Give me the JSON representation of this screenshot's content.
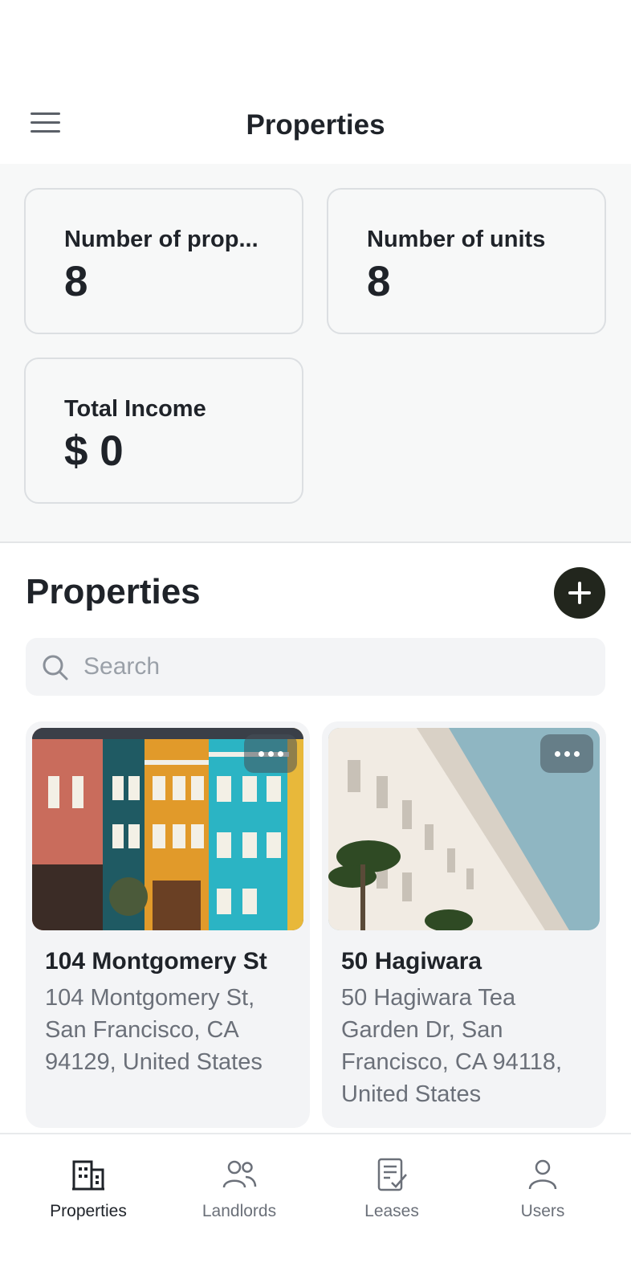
{
  "header": {
    "title": "Properties",
    "menu_icon": "menu-icon"
  },
  "stats": [
    {
      "label": "Number of prop...",
      "value": "8"
    },
    {
      "label": "Number of units",
      "value": "8"
    },
    {
      "label": "Total Income",
      "value": "$ 0"
    }
  ],
  "section": {
    "title": "Properties",
    "add_icon": "plus-icon"
  },
  "search": {
    "placeholder": "Search",
    "value": ""
  },
  "properties": [
    {
      "name": "104 Montgomery St",
      "address": "104 Montgomery St, San Francisco, CA 94129, United States",
      "image": "colorful-townhouses-photo"
    },
    {
      "name": "50 Hagiwara",
      "address": "50 Hagiwara Tea Garden Dr, San Francisco, CA 94118, United States",
      "image": "white-building-palms-photo"
    }
  ],
  "nav": [
    {
      "label": "Properties",
      "icon": "building-icon",
      "active": true
    },
    {
      "label": "Landlords",
      "icon": "people-icon",
      "active": false
    },
    {
      "label": "Leases",
      "icon": "document-check-icon",
      "active": false
    },
    {
      "label": "Users",
      "icon": "user-icon",
      "active": false
    }
  ],
  "colors": {
    "accent": "#22261d",
    "text": "#1f2329",
    "muted": "#6b7079",
    "surface": "#f3f4f6"
  }
}
